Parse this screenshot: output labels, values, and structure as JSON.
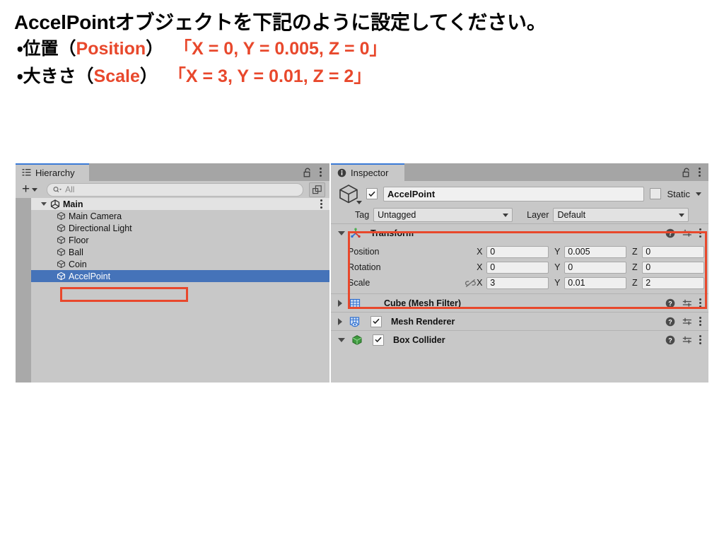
{
  "instructions": {
    "title": "AccelPointオブジェクトを下記のように設定してください。",
    "line1_prefix": "・位置（",
    "line1_term": "Position",
    "line1_mid": "）",
    "line1_value": "「X = 0, Y = 0.005, Z = 0」",
    "line2_prefix": "・大きさ（",
    "line2_term": "Scale",
    "line2_mid": "）",
    "line2_value": "「X = 3, Y = 0.01, Z = 2」",
    "accent_color": "#e8482c"
  },
  "hierarchy": {
    "tab_label": "Hierarchy",
    "tab_icon": "hierarchy-list-icon",
    "lock_icon": "padlock-open-icon",
    "menu_icon": "kebab-menu-icon",
    "add_label": "+",
    "search_placeholder": "All",
    "search_icon": "search-dropdown-icon",
    "expand_icon": "open-in-new-window-icon",
    "scene": {
      "label": "Main",
      "icon": "unity-scene-icon",
      "expanded": true
    },
    "items": [
      {
        "label": "Main Camera",
        "icon": "gameobject-cube-icon",
        "selected": false
      },
      {
        "label": "Directional Light",
        "icon": "gameobject-cube-icon",
        "selected": false
      },
      {
        "label": "Floor",
        "icon": "gameobject-cube-icon",
        "selected": false
      },
      {
        "label": "Ball",
        "icon": "gameobject-cube-icon",
        "selected": false
      },
      {
        "label": "Coin",
        "icon": "gameobject-cube-icon",
        "selected": false
      },
      {
        "label": "AccelPoint",
        "icon": "gameobject-cube-icon",
        "selected": true
      }
    ]
  },
  "inspector": {
    "tab_label": "Inspector",
    "tab_icon": "info-circle-icon",
    "lock_icon": "padlock-open-icon",
    "menu_icon": "kebab-menu-icon",
    "object": {
      "icon": "gameobject-cube-icon",
      "enabled": true,
      "name": "AccelPoint",
      "static_label": "Static",
      "static_checked": false
    },
    "tag": {
      "label": "Tag",
      "value": "Untagged"
    },
    "layer": {
      "label": "Layer",
      "value": "Default"
    },
    "transform": {
      "title": "Transform",
      "icon": "transform-axis-icon",
      "expanded": true,
      "help_icon": "help-circle-icon",
      "preset_icon": "preset-sliders-icon",
      "menu_icon": "kebab-menu-icon",
      "axis_labels": [
        "X",
        "Y",
        "Z"
      ],
      "rows": [
        {
          "name": "Position",
          "link_icon": "",
          "values": [
            "0",
            "0.005",
            "0"
          ]
        },
        {
          "name": "Rotation",
          "link_icon": "",
          "values": [
            "0",
            "0",
            "0"
          ]
        },
        {
          "name": "Scale",
          "link_icon": "constrain-proportions-off-icon",
          "values": [
            "3",
            "0.01",
            "2"
          ]
        }
      ]
    },
    "components": [
      {
        "title": "Cube (Mesh Filter)",
        "icon": "mesh-filter-icon",
        "expanded": false,
        "has_checkbox": false,
        "checked": false,
        "help_icon": "help-circle-icon",
        "preset_icon": "preset-sliders-icon",
        "menu_icon": "kebab-menu-icon"
      },
      {
        "title": "Mesh Renderer",
        "icon": "mesh-renderer-icon",
        "expanded": false,
        "has_checkbox": true,
        "checked": true,
        "help_icon": "help-circle-icon",
        "preset_icon": "preset-sliders-icon",
        "menu_icon": "kebab-menu-icon"
      },
      {
        "title": "Box Collider",
        "icon": "box-collider-icon",
        "expanded": true,
        "has_checkbox": true,
        "checked": true,
        "help_icon": "help-circle-icon",
        "preset_icon": "preset-sliders-icon",
        "menu_icon": "kebab-menu-icon"
      }
    ]
  }
}
